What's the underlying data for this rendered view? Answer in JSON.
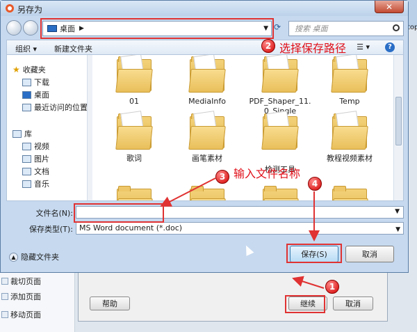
{
  "dialog": {
    "title": "另存为",
    "path_label": "桌面",
    "search_placeholder": "搜索 桌面",
    "toolbar": {
      "organize": "组织 ▾",
      "new_folder": "新建文件夹"
    },
    "nav": {
      "favorites": "收藏夹",
      "downloads": "下载",
      "desktop": "桌面",
      "recent": "最近访问的位置",
      "libraries": "库",
      "videos": "视频",
      "pictures": "图片",
      "documents": "文档",
      "music": "音乐"
    },
    "folders": [
      {
        "name": "01"
      },
      {
        "name": "MediaInfo"
      },
      {
        "name": "PDF_Shaper_11.\n0_Single"
      },
      {
        "name": "Temp"
      },
      {
        "name": "歌词"
      },
      {
        "name": "画笔素材"
      },
      {
        "name": "检测工具"
      },
      {
        "name": "教程视频素材"
      }
    ],
    "filename_label": "文件名(N):",
    "filename_value": "",
    "filetype_label": "保存类型(T):",
    "filetype_value": "MS Word document (*.doc)",
    "hide_folders": "隐藏文件夹",
    "save_button": "保存(S)",
    "cancel_button": "取消"
  },
  "background": {
    "sidebar_items": [
      "裁切页面",
      "添加页面",
      "移动页面"
    ],
    "help_button": "帮助",
    "continue_button": "继续",
    "cancel_button": "取消",
    "top_right": "top"
  },
  "annotations": {
    "step1": "1",
    "step2": "2",
    "step2_text": "选择保存路径",
    "step3": "3",
    "step3_text": "输入文件名称",
    "step4": "4",
    "color": "#e03232"
  }
}
